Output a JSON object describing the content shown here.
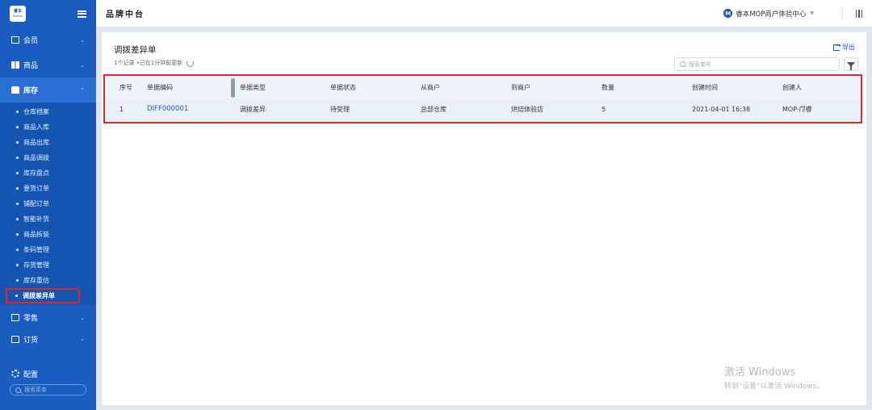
{
  "app": {
    "title": "品牌中台",
    "logo_text": "睿本",
    "logo_sub": "Ruiben"
  },
  "org": {
    "badge": "M",
    "name": "睿本MOP商户体验中心"
  },
  "sidebar": {
    "groups": [
      {
        "label": "会员"
      },
      {
        "label": "商品"
      },
      {
        "label": "库存"
      },
      {
        "label": "零售"
      },
      {
        "label": "订货"
      }
    ],
    "inventory_items": [
      {
        "label": "仓库档案"
      },
      {
        "label": "商品入库"
      },
      {
        "label": "商品出库"
      },
      {
        "label": "商品调拨"
      },
      {
        "label": "库存盘点"
      },
      {
        "label": "要货订单"
      },
      {
        "label": "铺配订单"
      },
      {
        "label": "智能补货"
      },
      {
        "label": "商品拆装"
      },
      {
        "label": "条码管理"
      },
      {
        "label": "存货管理"
      },
      {
        "label": "库存重估"
      },
      {
        "label": "调拨差异单"
      }
    ],
    "config_label": "配置",
    "search_placeholder": "搜索菜单"
  },
  "page": {
    "title": "调拨差异单",
    "meta": "1个记录 •已在1分钟前更新",
    "export_label": "导出",
    "search_placeholder": "搜索单号"
  },
  "table": {
    "headers": [
      "序号",
      "单据编码",
      "单据类型",
      "单据状态",
      "从商户",
      "到商户",
      "数量",
      "创建时间",
      "创建人"
    ],
    "rows": [
      {
        "no": "1",
        "code": "DIFF000001",
        "type": "调拨差异",
        "status": "待受理",
        "from": "总部仓库",
        "to": "烘焙体验店",
        "qty": "5",
        "created": "2021-04-01 16:38",
        "creator": "MOP-邝睿"
      }
    ]
  },
  "watermark": {
    "line1": "激活 Windows",
    "line2": "转到\"设置\"以激活 Windows。"
  }
}
